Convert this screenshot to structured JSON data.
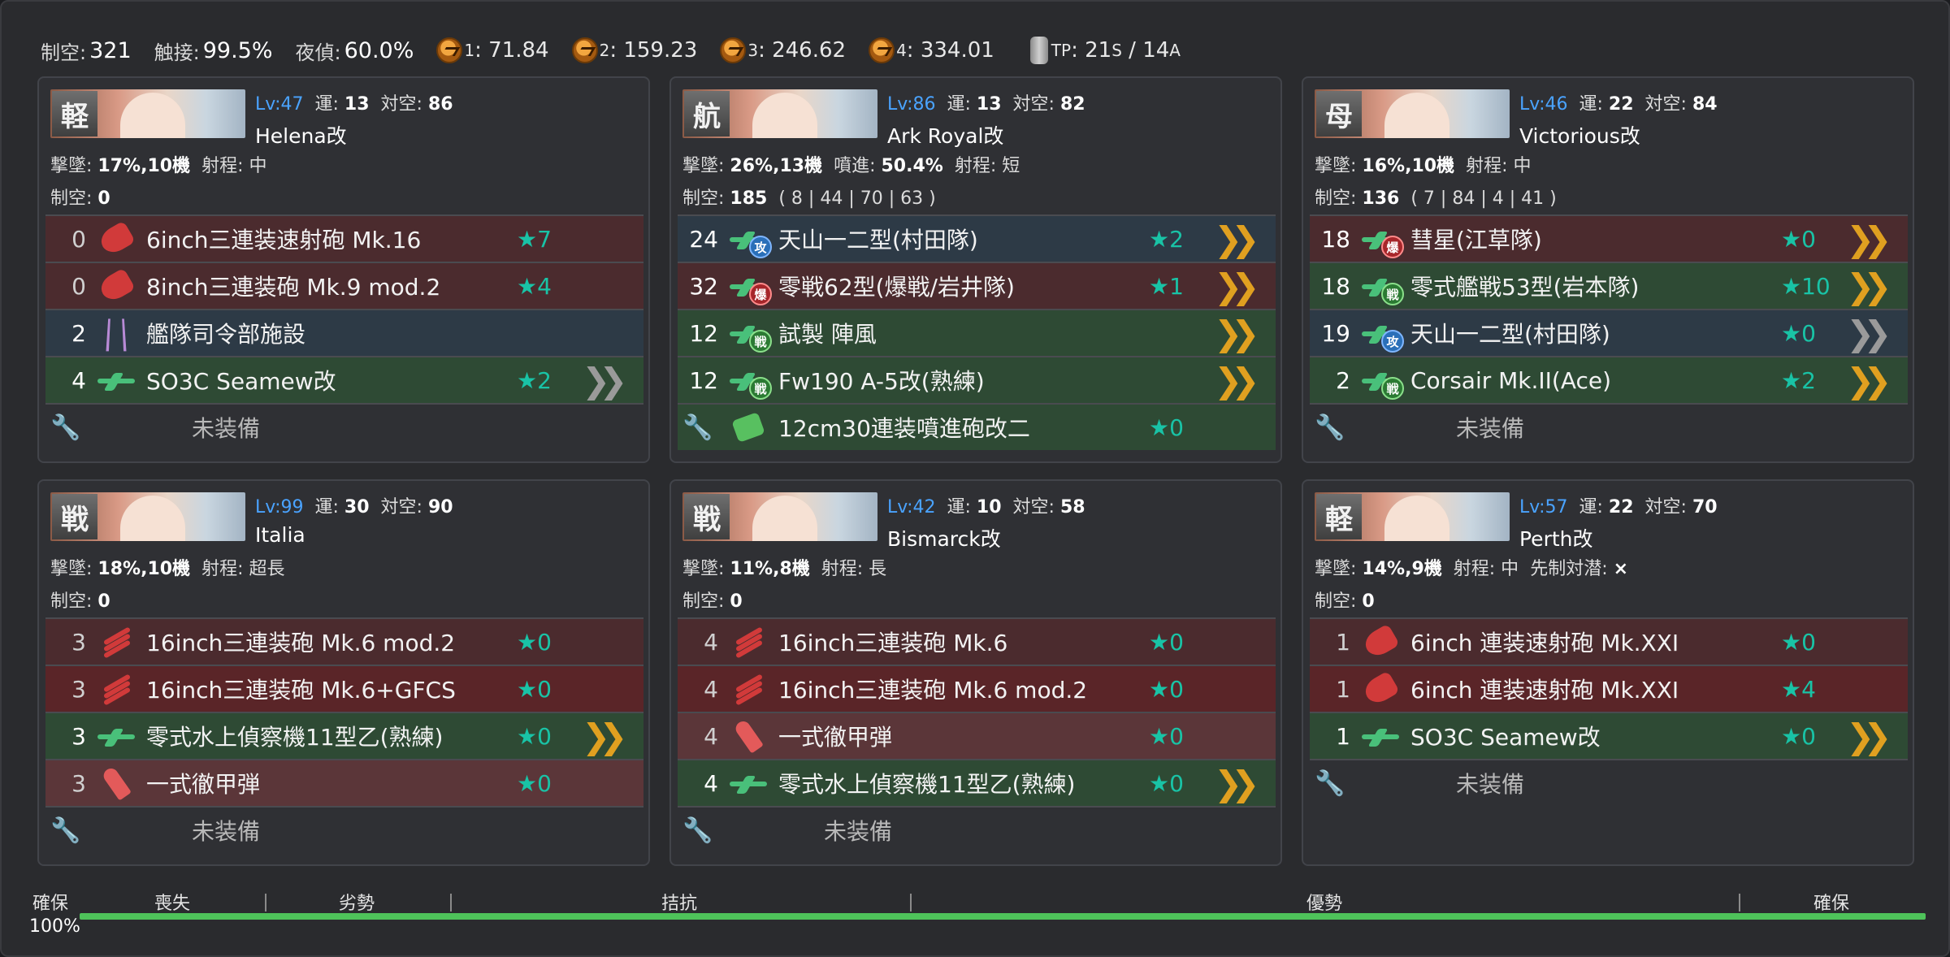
{
  "summary": {
    "air_label": "制空:",
    "air_value": "321",
    "contact_label": "触接:",
    "contact_value": "99.5%",
    "night_label": "夜偵:",
    "night_value": "60.0%",
    "waves": [
      {
        "sub": "1",
        "value": ": 71.84"
      },
      {
        "sub": "2",
        "value": ": 159.23"
      },
      {
        "sub": "3",
        "value": ": 246.62"
      },
      {
        "sub": "4",
        "value": ": 334.01"
      }
    ],
    "tp_sub": "TP",
    "tp_sep": ": ",
    "tp_s": "21",
    "s_sub": "S",
    "tp_a_pre": " / ",
    "tp_a": "14",
    "a_sub": "A"
  },
  "ships": [
    {
      "type": "軽",
      "lv": "Lv:47",
      "luck_label": "運:",
      "luck": "13",
      "aa_label": "対空:",
      "aa": "86",
      "name": "Helena改",
      "d1": [
        {
          "l": "撃墜:",
          "v": "17%,10機"
        },
        {
          "l": "射程:",
          "v": "中",
          "plain": true
        }
      ],
      "d2": [
        {
          "l": "制空:",
          "v": "0"
        }
      ],
      "slots": [
        {
          "cnt": "0",
          "icon": "gun",
          "name": "6inch三連装速射砲 Mk.16",
          "star": "★7",
          "bg": "red"
        },
        {
          "cnt": "0",
          "icon": "gun",
          "name": "8inch三連装砲 Mk.9 mod.2",
          "star": "★4",
          "bg": "red"
        },
        {
          "cnt": "2",
          "icon": "hq",
          "name": "艦隊司令部施設",
          "star": "",
          "bg": "blue"
        },
        {
          "cnt": "4",
          "icon": "plane",
          "name": "SO3C Seamew改",
          "star": "★2",
          "bg": "green",
          "prof": "gray"
        },
        {
          "cnt": "",
          "icon": "wrench",
          "name": "未装備",
          "star": "",
          "bg": "empty"
        }
      ]
    },
    {
      "type": "航",
      "lv": "Lv:86",
      "luck_label": "運:",
      "luck": "13",
      "aa_label": "対空:",
      "aa": "82",
      "name": "Ark Royal改",
      "d1": [
        {
          "l": "撃墜:",
          "v": "26%,13機"
        },
        {
          "l": "噴進:",
          "v": "50.4%"
        },
        {
          "l": "射程:",
          "v": "短",
          "plain": true
        }
      ],
      "d2": [
        {
          "l": "制空:",
          "v": "185"
        },
        {
          "l": "",
          "v": "( 8 | 44 | 70 | 63 )",
          "plain": true
        }
      ],
      "slots": [
        {
          "cnt": "24",
          "icon": "plane-atk",
          "name": "天山一二型(村田隊)",
          "star": "★2",
          "bg": "blue",
          "prof": "gold"
        },
        {
          "cnt": "32",
          "icon": "plane-bmb",
          "name": "零戦62型(爆戦/岩井隊)",
          "star": "★1",
          "bg": "red",
          "prof": "gold"
        },
        {
          "cnt": "12",
          "icon": "plane-ftr",
          "name": "試製 陣風",
          "star": "",
          "bg": "green",
          "prof": "gold"
        },
        {
          "cnt": "12",
          "icon": "plane-ftr",
          "name": "Fw190 A-5改(熟練)",
          "star": "",
          "bg": "green",
          "prof": "gold"
        },
        {
          "cnt": "",
          "icon": "aa",
          "name": "12cm30連装噴進砲改二",
          "star": "★0",
          "bg": "green",
          "wrench": true
        }
      ]
    },
    {
      "type": "母",
      "lv": "Lv:46",
      "luck_label": "運:",
      "luck": "22",
      "aa_label": "対空:",
      "aa": "84",
      "name": "Victorious改",
      "d1": [
        {
          "l": "撃墜:",
          "v": "16%,10機"
        },
        {
          "l": "射程:",
          "v": "中",
          "plain": true
        }
      ],
      "d2": [
        {
          "l": "制空:",
          "v": "136"
        },
        {
          "l": "",
          "v": "( 7 | 84 | 4 | 41 )",
          "plain": true
        }
      ],
      "slots": [
        {
          "cnt": "18",
          "icon": "plane-bmb",
          "name": "彗星(江草隊)",
          "star": "★0",
          "bg": "red",
          "prof": "gold"
        },
        {
          "cnt": "18",
          "icon": "plane-ftr",
          "name": "零式艦戦53型(岩本隊)",
          "star": "★10",
          "bg": "green",
          "prof": "gold"
        },
        {
          "cnt": "19",
          "icon": "plane-atk",
          "name": "天山一二型(村田隊)",
          "star": "★0",
          "bg": "blue",
          "prof": "gray"
        },
        {
          "cnt": "2",
          "icon": "plane-ftr",
          "name": "Corsair Mk.II(Ace)",
          "star": "★2",
          "bg": "green",
          "prof": "gold"
        },
        {
          "cnt": "",
          "icon": "wrench",
          "name": "未装備",
          "star": "",
          "bg": "empty"
        }
      ]
    },
    {
      "type": "戦",
      "lv": "Lv:99",
      "luck_label": "運:",
      "luck": "30",
      "aa_label": "対空:",
      "aa": "90",
      "name": "Italia",
      "d1": [
        {
          "l": "撃墜:",
          "v": "18%,10機"
        },
        {
          "l": "射程:",
          "v": "超長",
          "plain": true
        }
      ],
      "d2": [
        {
          "l": "制空:",
          "v": "0"
        }
      ],
      "slots": [
        {
          "cnt": "3",
          "icon": "bigun",
          "name": "16inch三連装砲 Mk.6 mod.2",
          "star": "★0",
          "bg": "red"
        },
        {
          "cnt": "3",
          "icon": "bigun",
          "name": "16inch三連装砲 Mk.6+GFCS",
          "star": "★0",
          "bg": "red2"
        },
        {
          "cnt": "3",
          "icon": "plane",
          "name": "零式水上偵察機11型乙(熟練)",
          "star": "★0",
          "bg": "green",
          "prof": "gold"
        },
        {
          "cnt": "3",
          "icon": "shell",
          "name": "一式徹甲弾",
          "star": "★0",
          "bg": "pink"
        },
        {
          "cnt": "",
          "icon": "wrench",
          "name": "未装備",
          "star": "",
          "bg": "empty"
        }
      ]
    },
    {
      "type": "戦",
      "lv": "Lv:42",
      "luck_label": "運:",
      "luck": "10",
      "aa_label": "対空:",
      "aa": "58",
      "name": "Bismarck改",
      "d1": [
        {
          "l": "撃墜:",
          "v": "11%,8機"
        },
        {
          "l": "射程:",
          "v": "長",
          "plain": true
        }
      ],
      "d2": [
        {
          "l": "制空:",
          "v": "0"
        }
      ],
      "slots": [
        {
          "cnt": "4",
          "icon": "bigun",
          "name": "16inch三連装砲 Mk.6",
          "star": "★0",
          "bg": "red"
        },
        {
          "cnt": "4",
          "icon": "bigun",
          "name": "16inch三連装砲 Mk.6 mod.2",
          "star": "★0",
          "bg": "red2"
        },
        {
          "cnt": "4",
          "icon": "shell",
          "name": "一式徹甲弾",
          "star": "★0",
          "bg": "pink"
        },
        {
          "cnt": "4",
          "icon": "plane",
          "name": "零式水上偵察機11型乙(熟練)",
          "star": "★0",
          "bg": "green",
          "prof": "gold"
        },
        {
          "cnt": "",
          "icon": "wrench",
          "name": "未装備",
          "star": "",
          "bg": "empty"
        }
      ]
    },
    {
      "type": "軽",
      "lv": "Lv:57",
      "luck_label": "運:",
      "luck": "22",
      "aa_label": "対空:",
      "aa": "70",
      "name": "Perth改",
      "d1": [
        {
          "l": "撃墜:",
          "v": "14%,9機"
        },
        {
          "l": "射程:",
          "v": "中",
          "plain": true
        },
        {
          "l": "先制対潜:",
          "v": "×"
        }
      ],
      "d2": [
        {
          "l": "制空:",
          "v": "0"
        }
      ],
      "slots": [
        {
          "cnt": "1",
          "icon": "gun",
          "name": "6inch 連装速射砲 Mk.XXI",
          "star": "★0",
          "bg": "red"
        },
        {
          "cnt": "1",
          "icon": "gun",
          "name": "6inch 連装速射砲 Mk.XXI",
          "star": "★4",
          "bg": "red2"
        },
        {
          "cnt": "1",
          "icon": "plane",
          "name": "SO3C Seamew改",
          "star": "★0",
          "bg": "green",
          "prof": "gold"
        },
        {
          "cnt": "",
          "icon": "wrench",
          "name": "未装備",
          "star": "",
          "bg": "empty"
        }
      ]
    }
  ],
  "air_state": {
    "labels": [
      "確保",
      "喪失",
      "劣勢",
      "拮抗",
      "優勢",
      "確保"
    ],
    "percent": "100%",
    "fill_fraction": 1.0,
    "color": "#4ec35a"
  },
  "colors": {
    "level": "#4aa3ff",
    "star": "#19c3a6",
    "proficiency": "#e0a020"
  }
}
